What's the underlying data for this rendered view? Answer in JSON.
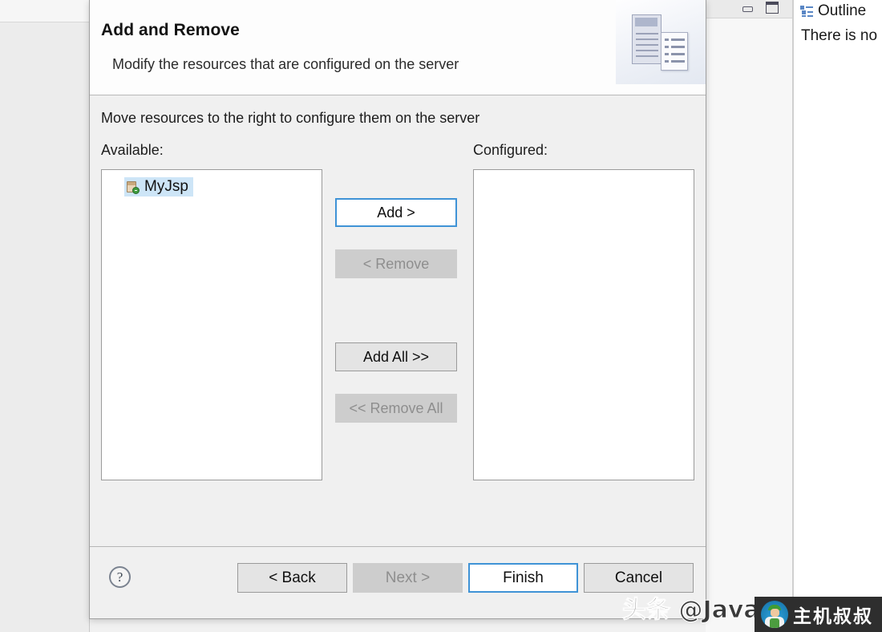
{
  "ide": {
    "outline": {
      "tab_label": "Outline",
      "icon": "outline-icon",
      "empty_message": "There is no"
    },
    "view_toolbar": {
      "minimize_icon": "minimize-icon",
      "maximize_icon": "maximize-icon"
    }
  },
  "dialog": {
    "header": {
      "title": "Add and Remove",
      "subtitle": "Modify the resources that are configured on the server",
      "banner_icon": "wizard-banner-image"
    },
    "body": {
      "instruction": "Move resources to the right to configure them on the server",
      "available_label": "Available:",
      "configured_label": "Configured:",
      "available_items": [
        {
          "label": "MyJsp",
          "icon": "web-project-icon",
          "selected": true
        }
      ],
      "configured_items": [],
      "transfer_buttons": [
        {
          "label": "Add >",
          "state": "focused"
        },
        {
          "label": "< Remove",
          "state": "disabled"
        },
        {
          "label": "Add All >>",
          "state": "enabled"
        },
        {
          "label": "<< Remove All",
          "state": "disabled"
        }
      ]
    },
    "footer": {
      "help_icon": "help-icon",
      "help_glyph": "?",
      "buttons": [
        {
          "label": "< Back",
          "state": "enabled"
        },
        {
          "label": "Next >",
          "state": "disabled"
        },
        {
          "label": "Finish",
          "state": "focused"
        },
        {
          "label": "Cancel",
          "state": "enabled"
        }
      ]
    }
  },
  "watermark": {
    "text": "头条 @Java技术叔叔",
    "logo_text": "主机叔叔",
    "logo_avatar": "person-avatar-icon"
  },
  "colors": {
    "focus_blue": "#3f93d6",
    "selection_blue": "#cde5f7",
    "dialog_bg": "#f0f0f0",
    "header_bg": "#fdfdfd",
    "disabled_gray": "#cdcdcd",
    "watermark_logo_bg": "#2e2e2e"
  }
}
